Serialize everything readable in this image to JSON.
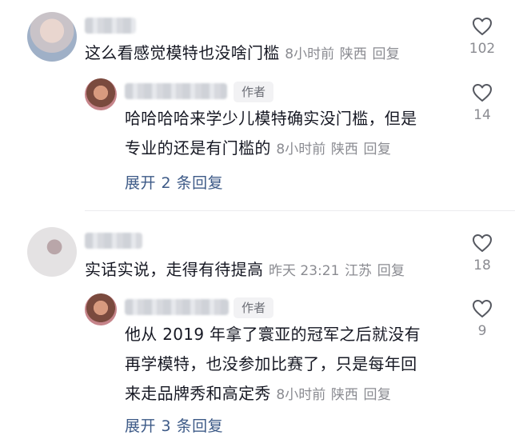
{
  "comments": [
    {
      "text": "这么看感觉模特也没啥门槛",
      "time": "8小时前",
      "location": "陕西",
      "reply_label": "回复",
      "likes": "102",
      "reply": {
        "author_badge": "作者",
        "text_line1": "哈哈哈哈来学少儿模特确实没门槛，但是",
        "text_line2": "专业的还是有门槛的",
        "time": "8小时前",
        "location": "陕西",
        "reply_label": "回复",
        "likes": "14"
      },
      "expand_label": "展开 2 条回复"
    },
    {
      "text": "实话实说，走得有待提高",
      "time": "昨天 23:21",
      "location": "江苏",
      "reply_label": "回复",
      "likes": "18",
      "reply": {
        "author_badge": "作者",
        "text_line1": "他从 2019 年拿了寰亚的冠军之后就没有",
        "text_line2": "再学模特，也没参加比赛了，只是每年回",
        "text_line3": "来走品牌秀和高定秀",
        "time": "8小时前",
        "location": "陕西",
        "reply_label": "回复",
        "likes": "9"
      },
      "expand_label": "展开 3 条回复"
    }
  ],
  "colors": {
    "text": "#161823",
    "meta": "#8a8b91",
    "expand": "#3d5a87"
  }
}
